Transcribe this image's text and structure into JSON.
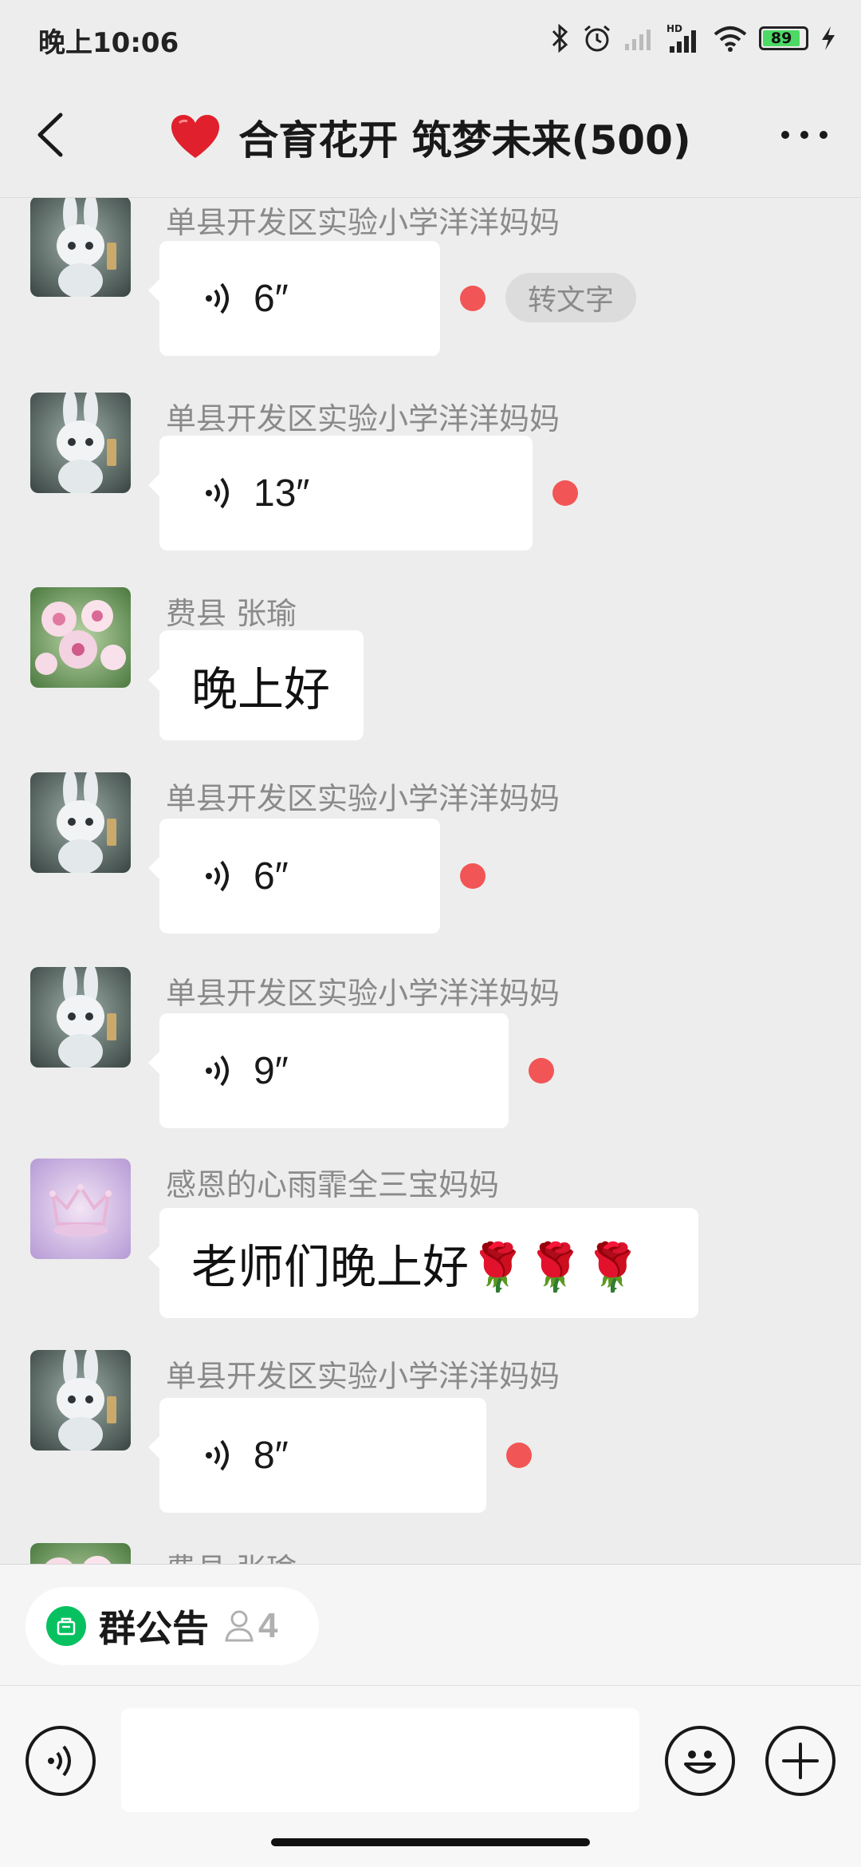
{
  "status_bar": {
    "time": "晚上10:06",
    "battery": "89",
    "icons": [
      "bluetooth-icon",
      "alarm-icon",
      "signal-icon",
      "hd-signal-icon",
      "wifi-icon",
      "battery-icon",
      "charging-icon"
    ]
  },
  "header": {
    "title_emoji": "❤️",
    "title": "合育花开 筑梦未来(500)",
    "back_icon": "chevron-left-icon",
    "more_icon": "more-dots-icon"
  },
  "messages": [
    {
      "sender": "单县开发区实验小学洋洋妈妈",
      "type": "voice",
      "duration": "6″",
      "unread": true,
      "to_text_label": "转文字",
      "avatar": "bunny"
    },
    {
      "sender": "单县开发区实验小学洋洋妈妈",
      "type": "voice",
      "duration": "13″",
      "unread": true,
      "avatar": "bunny"
    },
    {
      "sender": "费县 张瑜",
      "type": "text",
      "text": "晚上好",
      "avatar": "flowers"
    },
    {
      "sender": "单县开发区实验小学洋洋妈妈",
      "type": "voice",
      "duration": "6″",
      "unread": true,
      "avatar": "bunny"
    },
    {
      "sender": "单县开发区实验小学洋洋妈妈",
      "type": "voice",
      "duration": "9″",
      "unread": true,
      "avatar": "bunny"
    },
    {
      "sender": "感恩的心雨霏全三宝妈妈",
      "type": "text",
      "text": "老师们晚上好🌹🌹🌹",
      "avatar": "pink-crown"
    },
    {
      "sender": "单县开发区实验小学洋洋妈妈",
      "type": "voice",
      "duration": "8″",
      "unread": true,
      "avatar": "bunny"
    },
    {
      "sender": "费县 张瑜",
      "type": "partial",
      "avatar": "flowers"
    }
  ],
  "notice": {
    "label": "群公告",
    "count": "4"
  },
  "input": {
    "placeholder": ""
  },
  "colors": {
    "background": "#ededed",
    "bubble": "#ffffff",
    "unread_dot": "#f25555",
    "accent_green": "#07c160"
  }
}
